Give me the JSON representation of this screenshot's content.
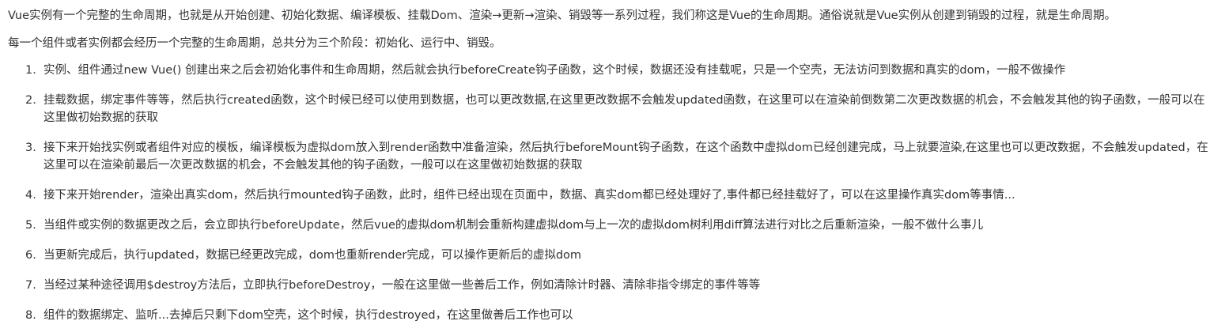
{
  "intro": {
    "paragraph1": "Vue实例有一个完整的生命周期，也就是从开始创建、初始化数据、编译模板、挂载Dom、渲染→更新→渲染、销毁等一系列过程，我们称这是Vue的生命周期。通俗说就是Vue实例从创建到销毁的过程，就是生命周期。",
    "paragraph2": "每一个组件或者实例都会经历一个完整的生命周期，总共分为三个阶段：初始化、运行中、销毁。"
  },
  "steps": [
    {
      "num": "1.",
      "text": "实例、组件通过new Vue() 创建出来之后会初始化事件和生命周期，然后就会执行beforeCreate钩子函数，这个时候，数据还没有挂载呢，只是一个空壳，无法访问到数据和真实的dom，一般不做操作"
    },
    {
      "num": "2.",
      "text": "挂载数据，绑定事件等等，然后执行created函数，这个时候已经可以使用到数据，也可以更改数据,在这里更改数据不会触发updated函数，在这里可以在渲染前倒数第二次更改数据的机会，不会触发其他的钩子函数，一般可以在这里做初始数据的获取"
    },
    {
      "num": "3.",
      "text": "接下来开始找实例或者组件对应的模板，编译模板为虚拟dom放入到render函数中准备渲染，然后执行beforeMount钩子函数，在这个函数中虚拟dom已经创建完成，马上就要渲染,在这里也可以更改数据，不会触发updated，在这里可以在渲染前最后一次更改数据的机会，不会触发其他的钩子函数，一般可以在这里做初始数据的获取"
    },
    {
      "num": "4.",
      "text": "接下来开始render，渲染出真实dom，然后执行mounted钩子函数，此时，组件已经出现在页面中，数据、真实dom都已经处理好了,事件都已经挂载好了，可以在这里操作真实dom等事情..."
    },
    {
      "num": "5.",
      "text": "当组件或实例的数据更改之后，会立即执行beforeUpdate，然后vue的虚拟dom机制会重新构建虚拟dom与上一次的虚拟dom树利用diff算法进行对比之后重新渲染，一般不做什么事儿"
    },
    {
      "num": "6.",
      "text": "当更新完成后，执行updated，数据已经更改完成，dom也重新render完成，可以操作更新后的虚拟dom"
    },
    {
      "num": "7.",
      "text": "当经过某种途径调用$destroy方法后，立即执行beforeDestroy，一般在这里做一些善后工作，例如清除计时器、清除非指令绑定的事件等等"
    },
    {
      "num": "8.",
      "text": "组件的数据绑定、监听...去掉后只剩下dom空壳，这个时候，执行destroyed，在这里做善后工作也可以"
    }
  ]
}
